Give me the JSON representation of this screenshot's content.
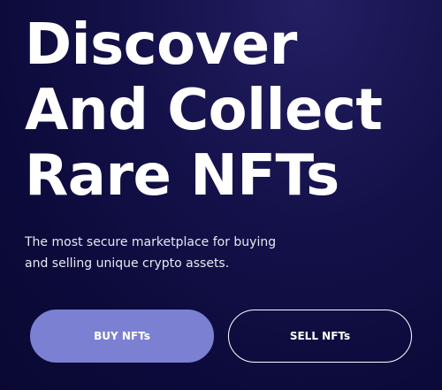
{
  "hero": {
    "headline_lines": [
      "Discover",
      "And Collect",
      "Rare NFTs"
    ],
    "subtitle_lines": [
      "The most secure marketplace for buying",
      "and selling unique crypto assets."
    ]
  },
  "actions": {
    "buy_label": "BUY NFTs",
    "sell_label": "SELL NFTs"
  },
  "colors": {
    "background": "#0c0a3a",
    "primary_button": "#7b80d2",
    "text": "#ffffff"
  }
}
